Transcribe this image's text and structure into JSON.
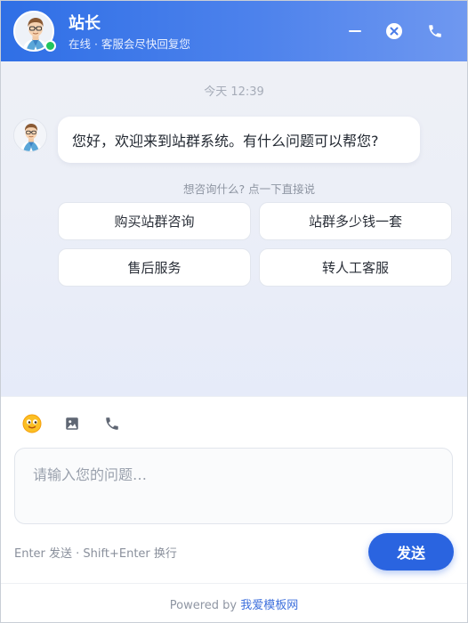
{
  "header": {
    "agent_name": "站长",
    "status_text": "在线 · 客服会尽快回复您"
  },
  "chat": {
    "timestamp": "今天 12:39",
    "greeting": "您好，欢迎来到站群系统。有什么问题可以帮您?",
    "quick_hint": "想咨询什么? 点一下直接说",
    "quick_replies": [
      {
        "label": "购买站群咨询"
      },
      {
        "label": "站群多少钱一套"
      },
      {
        "label": "售后服务"
      },
      {
        "label": "转人工客服"
      }
    ]
  },
  "composer": {
    "placeholder": "请输入您的问题…",
    "tools": [
      "emoji-icon",
      "image-icon",
      "phone-icon"
    ],
    "keyboard_hint": "Enter 发送 · Shift+Enter 换行",
    "send_label": "发送"
  },
  "footer": {
    "powered_by": "Powered by",
    "brand": "我爱模板网"
  },
  "colors": {
    "primary": "#2a64e0",
    "header_gradient_start": "#2f6fe6",
    "header_gradient_end": "#6f98f0",
    "online": "#22c55e"
  }
}
